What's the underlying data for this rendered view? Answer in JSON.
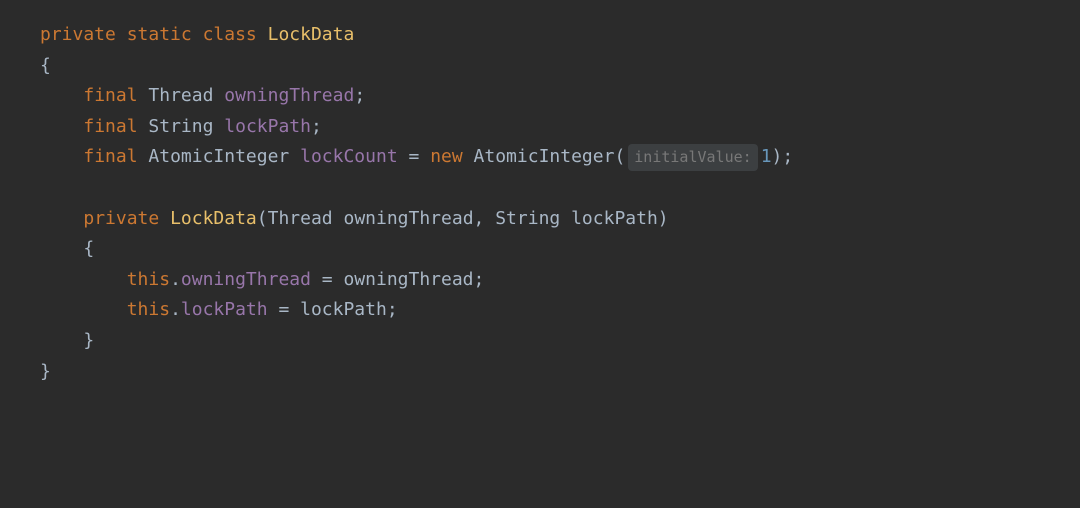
{
  "code": {
    "line1": {
      "kw_private": "private",
      "kw_static": "static",
      "kw_class": "class",
      "classname": "LockData"
    },
    "line2": {
      "brace": "{"
    },
    "line3": {
      "kw_final": "final",
      "type": "Thread",
      "var": "owningThread",
      "semi": ";"
    },
    "line4": {
      "kw_final": "final",
      "type": "String",
      "var": "lockPath",
      "semi": ";"
    },
    "line5": {
      "kw_final": "final",
      "type": "AtomicInteger",
      "var": "lockCount",
      "eq": " = ",
      "kw_new": "new",
      "ctor": "AtomicInteger",
      "lparen": "(",
      "hint": "initialValue:",
      "val": "1",
      "rparen": ")",
      "semi": ";"
    },
    "line7": {
      "kw_private": "private",
      "ctor": "LockData",
      "lparen": "(",
      "ptype1": "Thread",
      "pname1": "owningThread",
      "comma": ", ",
      "ptype2": "String",
      "pname2": "lockPath",
      "rparen": ")"
    },
    "line8": {
      "brace": "{"
    },
    "line9": {
      "kw_this": "this",
      "dot": ".",
      "field": "owningThread",
      "eq": " = ",
      "rhs": "owningThread",
      "semi": ";"
    },
    "line10": {
      "kw_this": "this",
      "dot": ".",
      "field": "lockPath",
      "eq": " = ",
      "rhs": "lockPath",
      "semi": ";"
    },
    "line11": {
      "brace": "}"
    },
    "line12": {
      "brace": "}"
    }
  }
}
